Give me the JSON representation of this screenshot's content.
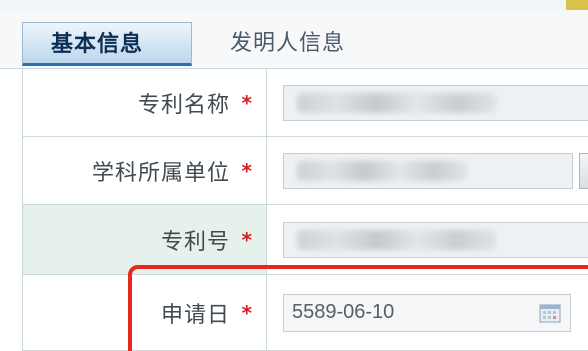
{
  "tabs": [
    {
      "label": "基本信息",
      "active": true
    },
    {
      "label": "发明人信息",
      "active": false
    }
  ],
  "form": {
    "required_mark": "*",
    "rows": [
      {
        "label": "专利名称"
      },
      {
        "label": "学科所属单位"
      },
      {
        "label": "专利号"
      },
      {
        "label": "申请日",
        "value": "5589-06-10"
      }
    ]
  },
  "colors": {
    "required": "#d21f1f",
    "highlight": "#e8261e",
    "active_tab_border": "#2f6fb0"
  }
}
